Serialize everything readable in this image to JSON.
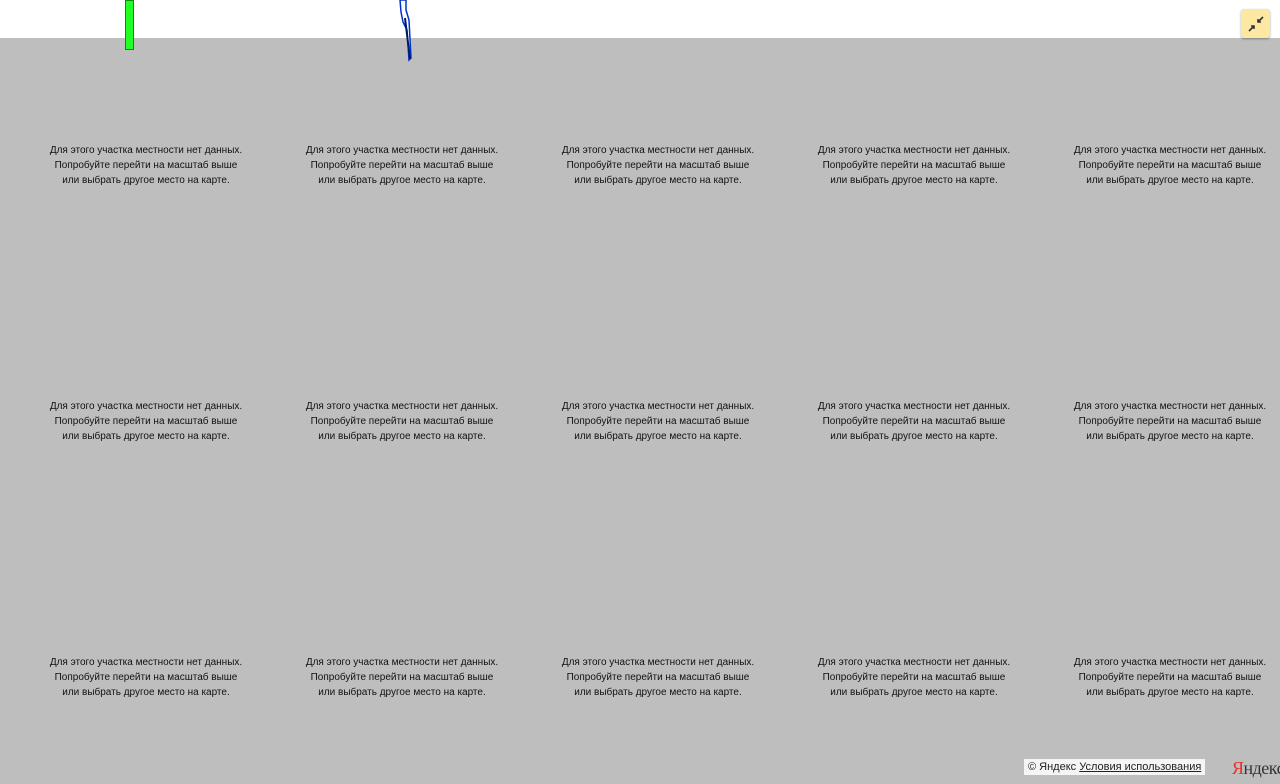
{
  "map": {
    "empty_tile_lines": [
      "Для этого участка местности нет данных.",
      "Попробуйте перейти на масштаб выше",
      "или выбрать другое место на карте."
    ]
  },
  "controls": {
    "fullscreen_icon": "collapse-arrows-icon",
    "accent_color": "#fce8a3"
  },
  "attribution": {
    "copyright": "© Яндекс",
    "terms_link": "Условия использования"
  },
  "logo": {
    "first_letter": "Я",
    "rest": "ндекс"
  },
  "markers": {
    "green_color": "#22ff22",
    "blue_color": "#0033cc"
  }
}
